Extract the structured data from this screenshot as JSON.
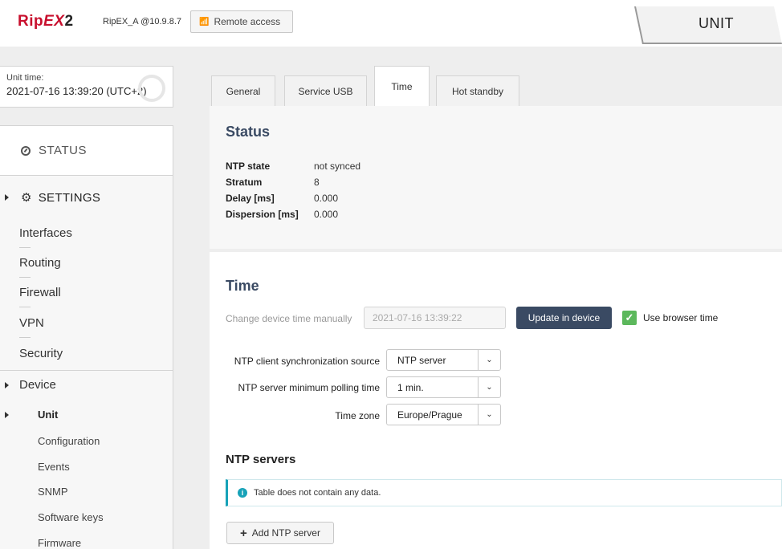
{
  "header": {
    "logo_main": "Rip",
    "logo_e": "EX",
    "logo_two": "2",
    "unit_name": "RipEX_A @10.9.8.7",
    "remote_access_label": "Remote access",
    "unit_tab_label": "UNIT"
  },
  "unit_time": {
    "label": "Unit time:",
    "value": "2021-07-16 13:39:20 (UTC+2)"
  },
  "sidebar": {
    "status_label": "STATUS",
    "settings_label": "SETTINGS",
    "items": [
      "Interfaces",
      "Routing",
      "Firewall",
      "VPN",
      "Security"
    ],
    "device_label": "Device",
    "device_items": [
      "Unit",
      "Configuration",
      "Events",
      "SNMP",
      "Software keys",
      "Firmware"
    ]
  },
  "tabs": [
    "General",
    "Service USB",
    "Time",
    "Hot standby"
  ],
  "active_tab": "Time",
  "status": {
    "title": "Status",
    "rows": [
      {
        "key": "NTP state",
        "value": "not synced"
      },
      {
        "key": "Stratum",
        "value": "8"
      },
      {
        "key": "Delay [ms]",
        "value": "0.000"
      },
      {
        "key": "Dispersion [ms]",
        "value": "0.000"
      }
    ]
  },
  "time": {
    "title": "Time",
    "manual_label": "Change device time manually",
    "manual_value": "2021-07-16 13:39:22",
    "update_button": "Update in device",
    "use_browser_label": "Use browser time",
    "use_browser_checked": true,
    "ntp_source_label": "NTP client synchronization source",
    "ntp_source_value": "NTP server",
    "polling_label": "NTP server minimum polling time",
    "polling_value": "1 min.",
    "timezone_label": "Time zone",
    "timezone_value": "Europe/Prague"
  },
  "ntp_servers": {
    "title": "NTP servers",
    "empty_message": "Table does not contain any data.",
    "add_button": "Add NTP server"
  },
  "colors": {
    "brand_red": "#c8102e",
    "primary_button": "#3a4a63",
    "checkbox_green": "#5cb85c",
    "info_teal": "#17a2b8"
  }
}
